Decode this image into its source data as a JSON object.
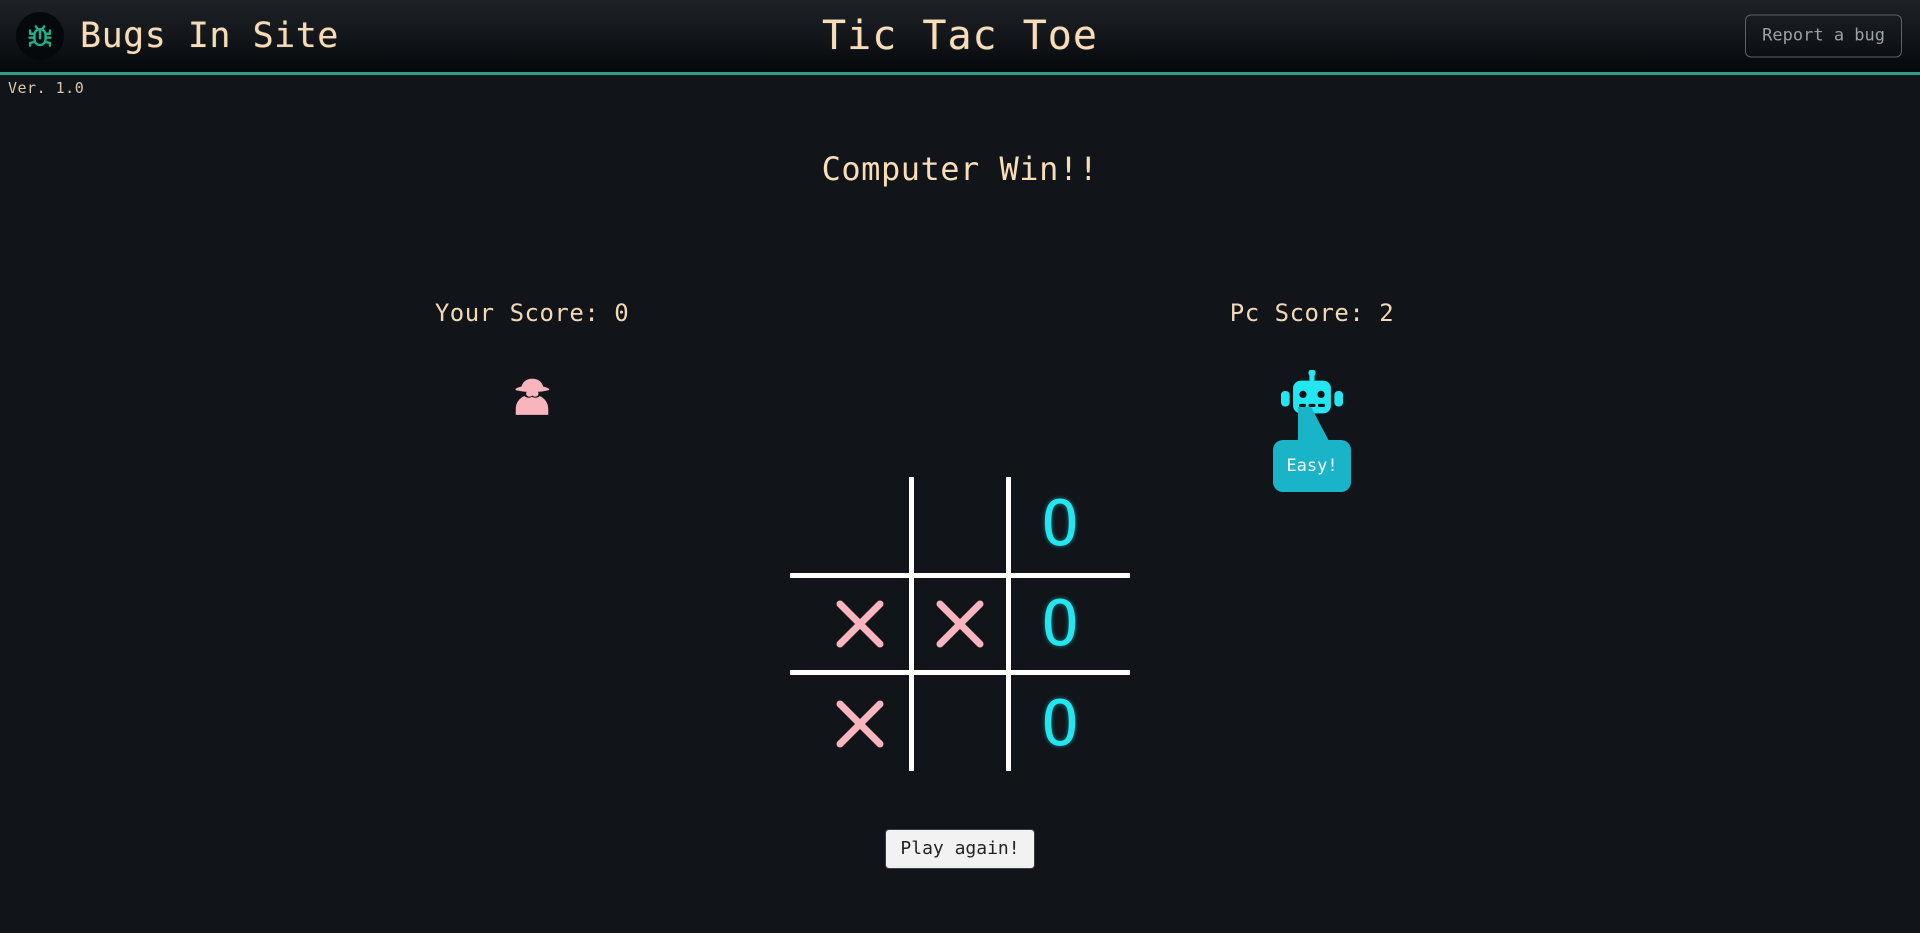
{
  "header": {
    "brand_name": "Bugs In Site",
    "logo_icon": "bug-icon",
    "title": "Tic Tac Toe",
    "report_bug_label": "Report a bug",
    "accent_color": "#2e9e86",
    "text_color": "#f6dcb6"
  },
  "version": {
    "label": "Ver. 1.0"
  },
  "game": {
    "result_message": "Computer Win!!",
    "player": {
      "score_label": "Your Score: 0",
      "avatar_icon": "spy-detective-icon",
      "mark_color": "#f9b5bd"
    },
    "computer": {
      "score_label": "Pc Score: 2",
      "avatar_icon": "robot-icon",
      "taunt": "Easy!",
      "mark_color": "#22e7f0",
      "bubble_color": "#1ab4c8"
    },
    "board": {
      "cells": [
        "",
        "",
        "O",
        "X",
        "X",
        "O",
        "X",
        "",
        "O"
      ],
      "line_color": "#ffffff"
    },
    "play_again_label": "Play again!"
  }
}
